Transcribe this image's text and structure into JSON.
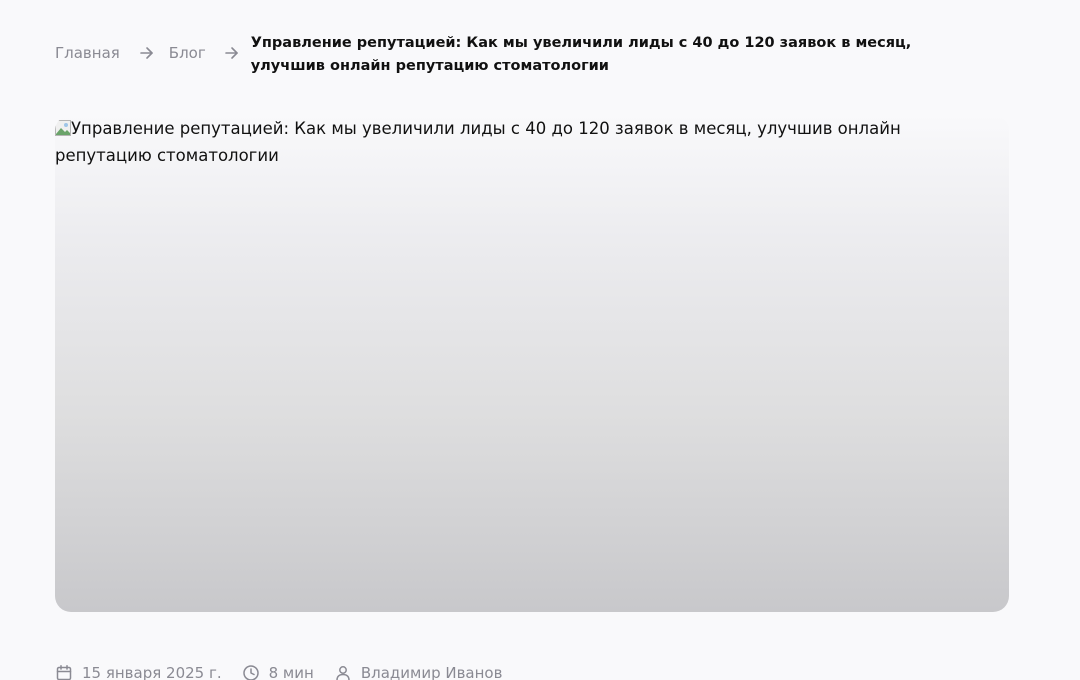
{
  "breadcrumb": {
    "home_label": "Главная",
    "blog_label": "Блог",
    "current_label": "Управление репутацией: Как мы увеличили лиды с 40 до 120 заявок в месяц, улучшив онлайн репутацию стоматологии"
  },
  "hero": {
    "alt_text": "Управление репутацией: Как мы увеличили лиды с 40 до 120 заявок в месяц, улучшив онлайн репутацию стоматологии"
  },
  "meta": {
    "date": "15 января 2025 г.",
    "read_time": "8 мин",
    "author": "Владимир Иванов",
    "date_icon": "calendar-icon",
    "time_icon": "clock-icon",
    "author_icon": "user-icon"
  },
  "colors": {
    "background": "#f9f9fb",
    "muted_text": "#8a8a93",
    "primary_text": "#111111"
  }
}
